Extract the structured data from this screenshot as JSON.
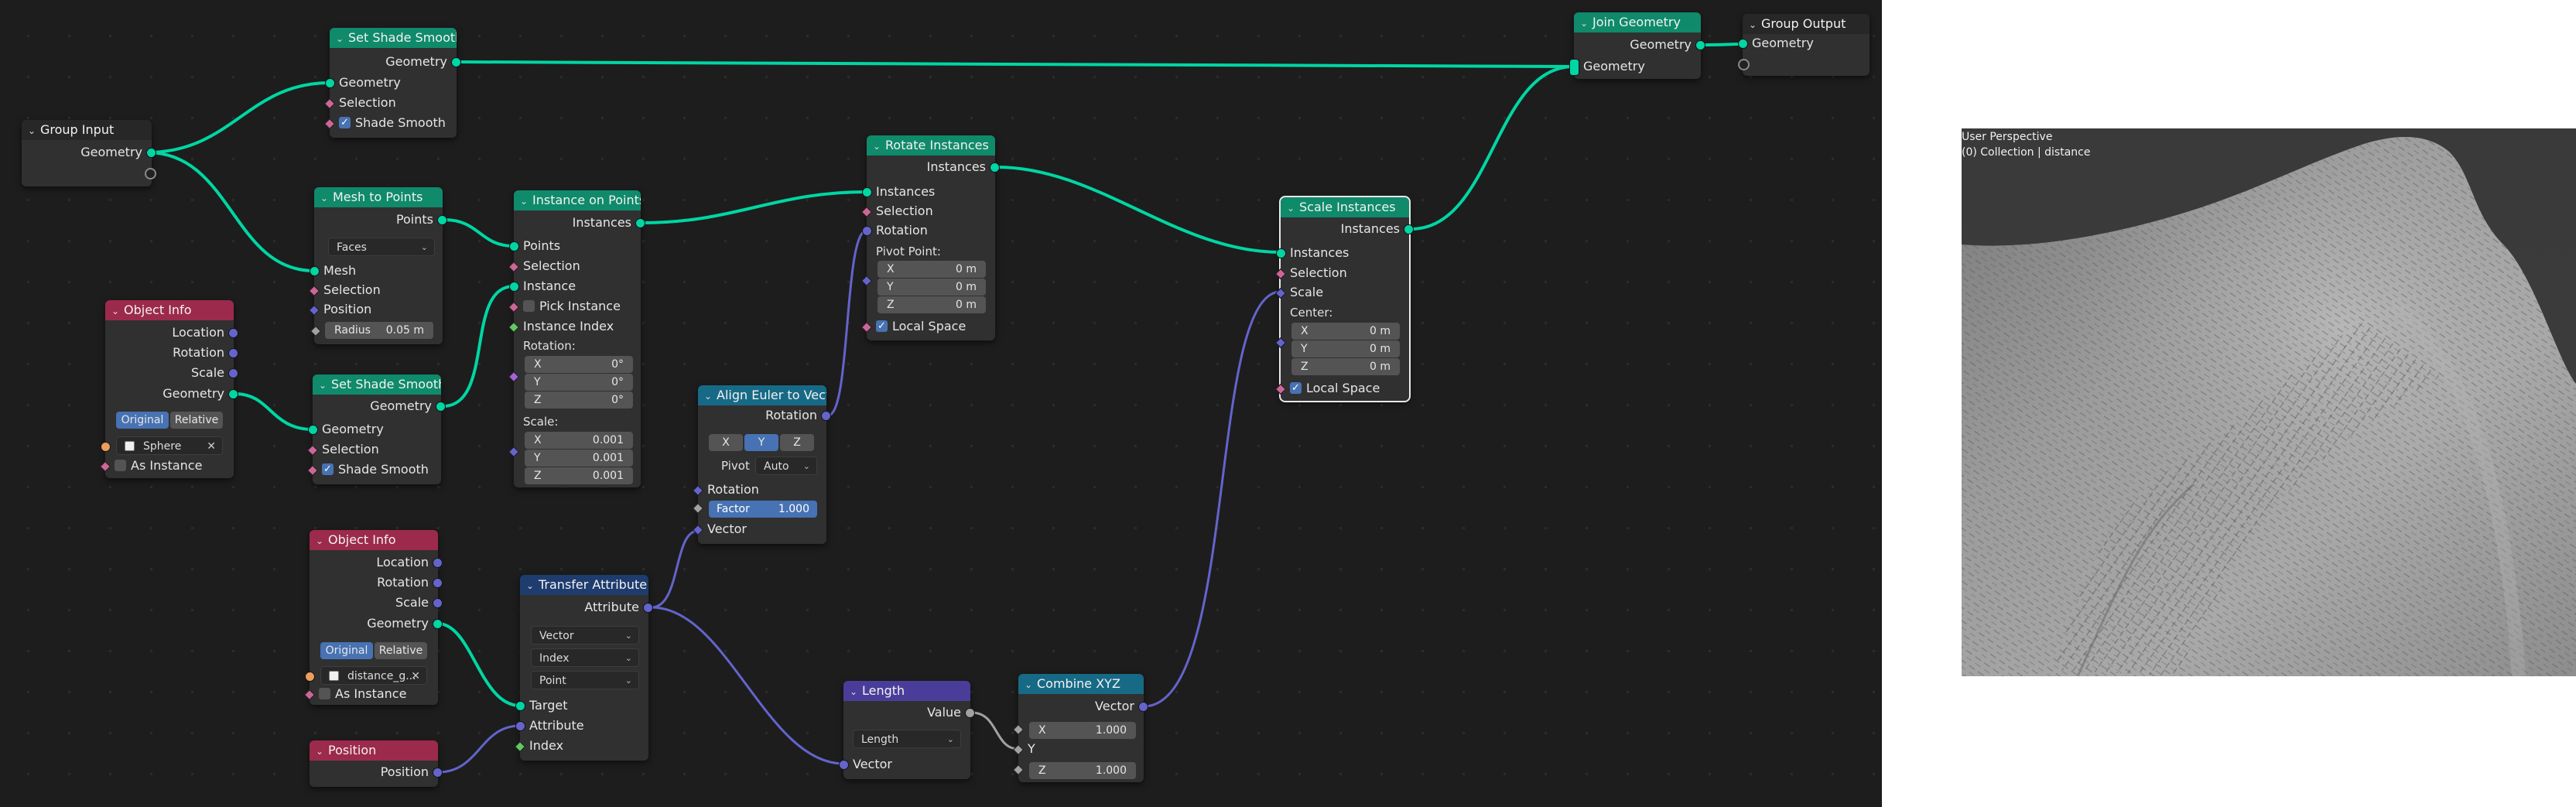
{
  "nodes": {
    "group_input": {
      "title": "Group Input",
      "out_geometry": "Geometry"
    },
    "set_shade_smooth_top": {
      "title": "Set Shade Smooth",
      "out_geometry": "Geometry",
      "in_geometry": "Geometry",
      "in_selection": "Selection",
      "shade_smooth": "Shade Smooth"
    },
    "mesh_to_points": {
      "title": "Mesh to Points",
      "out_points": "Points",
      "mode": "Faces",
      "in_mesh": "Mesh",
      "in_selection": "Selection",
      "in_position": "Position",
      "radius_label": "Radius",
      "radius_value": "0.05 m"
    },
    "instance_on_points": {
      "title": "Instance on Points",
      "out_instances": "Instances",
      "in_points": "Points",
      "in_selection": "Selection",
      "in_instance": "Instance",
      "pick_instance": "Pick Instance",
      "instance_index": "Instance Index",
      "rotation_label": "Rotation:",
      "rot_x": "0°",
      "rot_y": "0°",
      "rot_z": "0°",
      "scale_label": "Scale:",
      "scale_x": "0.001",
      "scale_y": "0.001",
      "scale_z": "0.001",
      "x": "X",
      "y": "Y",
      "z": "Z"
    },
    "object_info_1": {
      "title": "Object Info",
      "location": "Location",
      "rotation": "Rotation",
      "scale": "Scale",
      "geometry": "Geometry",
      "original": "Original",
      "relative": "Relative",
      "object": "Sphere",
      "as_instance": "As Instance"
    },
    "set_shade_smooth_mid": {
      "title": "Set Shade Smooth",
      "out_geometry": "Geometry",
      "in_geometry": "Geometry",
      "in_selection": "Selection",
      "shade_smooth": "Shade Smooth"
    },
    "rotate_instances": {
      "title": "Rotate Instances",
      "out_instances": "Instances",
      "in_instances": "Instances",
      "in_selection": "Selection",
      "in_rotation": "Rotation",
      "pivot_label": "Pivot Point:",
      "x_val": "0 m",
      "y_val": "0 m",
      "z_val": "0 m",
      "local_space": "Local Space",
      "x": "X",
      "y": "Y",
      "z": "Z"
    },
    "align_euler": {
      "title": "Align Euler to Vector",
      "out_rotation": "Rotation",
      "axis_x": "X",
      "axis_y": "Y",
      "axis_z": "Z",
      "pivot_label": "Pivot",
      "pivot_value": "Auto",
      "in_rotation": "Rotation",
      "factor_label": "Factor",
      "factor_value": "1.000",
      "in_vector": "Vector"
    },
    "scale_instances": {
      "title": "Scale Instances",
      "out_instances": "Instances",
      "in_instances": "Instances",
      "in_selection": "Selection",
      "in_scale": "Scale",
      "center_label": "Center:",
      "x_val": "0 m",
      "y_val": "0 m",
      "z_val": "0 m",
      "local_space": "Local Space",
      "x": "X",
      "y": "Y",
      "z": "Z"
    },
    "join_geometry": {
      "title": "Join Geometry",
      "out_geometry": "Geometry",
      "in_geometry": "Geometry"
    },
    "group_output": {
      "title": "Group Output",
      "in_geometry": "Geometry"
    },
    "object_info_2": {
      "title": "Object Info",
      "location": "Location",
      "rotation": "Rotation",
      "scale": "Scale",
      "geometry": "Geometry",
      "original": "Original",
      "relative": "Relative",
      "object": "distance_g...",
      "as_instance": "As Instance"
    },
    "transfer_attribute": {
      "title": "Transfer Attribute",
      "out_attribute": "Attribute",
      "data_type": "Vector",
      "mapping": "Index",
      "domain": "Point",
      "in_target": "Target",
      "in_attribute": "Attribute",
      "in_index": "Index"
    },
    "position": {
      "title": "Position",
      "out_position": "Position"
    },
    "length": {
      "title": "Length",
      "out_value": "Value",
      "operation": "Length",
      "in_vector": "Vector"
    },
    "combine_xyz": {
      "title": "Combine XYZ",
      "out_vector": "Vector",
      "x_label": "X",
      "x_value": "1.000",
      "y_label": "Y",
      "z_label": "Z",
      "z_value": "1.000"
    }
  },
  "viewport": {
    "title": "User Perspective",
    "subtitle": "(0) Collection | distance"
  },
  "colors": {
    "geometry_socket": "#00d6a3",
    "vector_socket": "#6464cc",
    "float_socket": "#a1a1a1",
    "geometry_header": "#0f8a6a",
    "input_header": "#9c2a4c",
    "selected_outline": "#e8e8e8"
  }
}
